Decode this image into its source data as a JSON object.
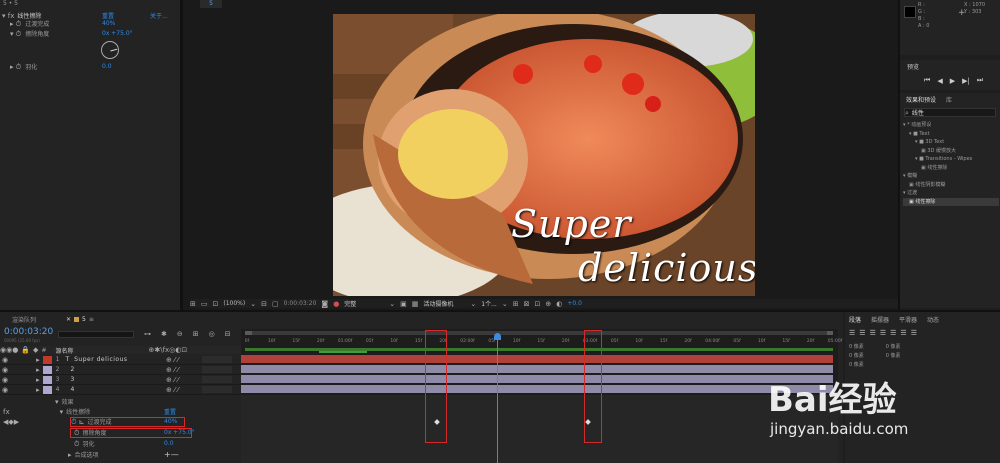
{
  "effect_controls": {
    "top_label": "5 • 5",
    "effect_name": "线性擦除",
    "reset": "重置",
    "about": "关于...",
    "props": [
      {
        "name": "过渡完成",
        "value": "40%"
      },
      {
        "name": "擦除角度",
        "value": "0x +75.0°"
      },
      {
        "name": "羽化",
        "value": "0.0"
      }
    ]
  },
  "comp_tab": "5",
  "viewer": {
    "overlay_text_line1": "Super",
    "overlay_text_line2": "delicious",
    "zoom": "(100%)",
    "time": "0:00:03:20",
    "quality": "完整",
    "camera": "活动摄像机",
    "views": "1个...",
    "exposure": "+0.0"
  },
  "info_panel": {
    "r": "R :",
    "g": "G :",
    "b": "B :",
    "a": "A : 0",
    "x": "X : 1070",
    "y": "Y : 303"
  },
  "preview": {
    "title": "预览"
  },
  "effects_presets": {
    "tab1": "效果和预设",
    "tab2": "库",
    "search_value": "线性",
    "tree": [
      {
        "label": "* 动画预设",
        "indent": 0
      },
      {
        "label": "Text",
        "indent": 1
      },
      {
        "label": "3D Text",
        "indent": 2
      },
      {
        "label": "3D 缓慢放大",
        "indent": 3
      },
      {
        "label": "Transitions - Wipes",
        "indent": 2
      },
      {
        "label": "线性擦除",
        "indent": 3
      },
      {
        "label": "模糊",
        "indent": 0
      },
      {
        "label": "线性阴影模糊",
        "indent": 1
      },
      {
        "label": "过渡",
        "indent": 0
      },
      {
        "label": "线性擦除",
        "indent": 1
      }
    ]
  },
  "align_panel": {
    "tab1": "段落",
    "tab2": "摇摆器",
    "tab3": "平滑器",
    "tab4": "动态",
    "value": "0 像素"
  },
  "timeline": {
    "tab_render": "渲染队列",
    "tab_comp": "5",
    "timecode": "0:00:03:20",
    "timecode_sub": "00095 (25.00 fps)",
    "source_name_header": "源名称",
    "layers": [
      {
        "num": "1",
        "type": "T",
        "name": "Super  delicious",
        "color": "#c0392b"
      },
      {
        "num": "2",
        "type": "",
        "name": "2",
        "color": "#b0a7d0"
      },
      {
        "num": "3",
        "type": "",
        "name": "3",
        "color": "#b0a7d0"
      },
      {
        "num": "4",
        "type": "",
        "name": "4",
        "color": "#b0a7d0"
      }
    ],
    "effects_group": "效果",
    "effect_name": "线性擦除",
    "effect_reset": "重置",
    "props": [
      {
        "name": "过渡完成",
        "value": "40%"
      },
      {
        "name": "擦除角度",
        "value": "0x +75.0°"
      },
      {
        "name": "羽化",
        "value": "0.0"
      }
    ],
    "composite": "合成选项",
    "ruler": [
      "0f",
      "10f",
      "15f",
      "20f",
      "01:00f",
      "05f",
      "10f",
      "15f",
      "20f",
      "02:00f",
      "05f",
      "10f",
      "15f",
      "20f",
      "03:00f",
      "05f",
      "10f",
      "15f",
      "20f",
      "04:00f",
      "05f",
      "10f",
      "15f",
      "20f",
      "05:00f"
    ]
  },
  "watermark": {
    "brand": "Bai经验",
    "url": "jingyan.baidu.com"
  }
}
